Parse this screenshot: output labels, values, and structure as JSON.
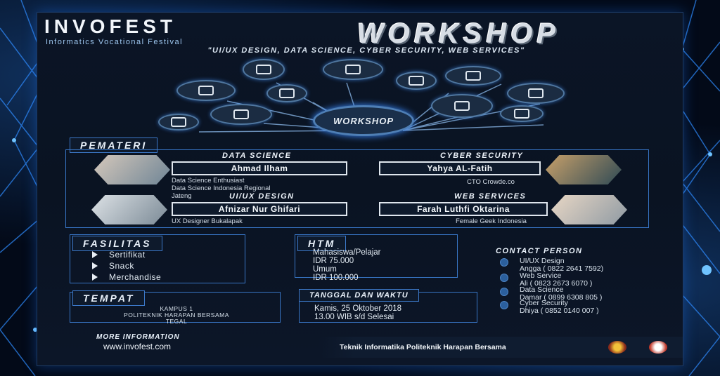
{
  "logo": {
    "name": "INVOFEST",
    "subtitle": "Informatics Vocational Festival"
  },
  "title": "WORKSHOP",
  "topics": "\"UI/UX DESIGN, DATA SCIENCE, CYBER SECURITY, WEB SERVICES\"",
  "center_node": "WORKSHOP",
  "sections": {
    "pemateri": "PEMATERI",
    "fasilitas": "FASILITAS",
    "htm": "HTM",
    "tempat": "TEMPAT",
    "tanggal": "TANGGAL DAN WAKTU",
    "contact": "CONTACT PERSON",
    "more": "MORE INFORMATION"
  },
  "speakers": [
    {
      "topic": "DATA SCIENCE",
      "name": "Ahmad Ilham",
      "desc": [
        "Data Science Enthusiast",
        "Data Science Indonesia Regional",
        "Jateng"
      ]
    },
    {
      "topic": "CYBER SECURITY",
      "name": "Yahya AL-Fatih",
      "desc": [
        "CTO Crowde.co"
      ]
    },
    {
      "topic": "UI/UX DESIGN",
      "name": "Afnizar Nur Ghifari",
      "desc": [
        "UX Designer Bukalapak"
      ]
    },
    {
      "topic": "WEB SERVICES",
      "name": "Farah Luthfi Oktarina",
      "desc": [
        "Female Geek Indonesia"
      ]
    }
  ],
  "fasilitas": [
    "Sertifikat",
    "Snack",
    "Merchandise"
  ],
  "htm": [
    "Mahasiswa/Pelajar",
    "IDR 75.000",
    "Umum",
    "IDR 100.000"
  ],
  "tempat": [
    "KAMPUS 1",
    "POLITEKNIK HARAPAN BERSAMA",
    "TEGAL"
  ],
  "tanggal": [
    "Kamis, 25 Oktober 2018",
    "13.00 WIB s/d Selesai"
  ],
  "contacts": [
    {
      "topic": "UI/UX Design",
      "person": "Angga ( 0822 2641 7592)"
    },
    {
      "topic": "Web Service",
      "person": "Ali ( 0823 2673 6070 )"
    },
    {
      "topic": "Data Science",
      "person": "Damar ( 0899 6308 805 )"
    },
    {
      "topic": "Cyber Security",
      "person": "Dhiya ( 0852 0140 007 )"
    }
  ],
  "website": "www.invofest.com",
  "footer": "Teknik Informatika Politeknik Harapan Bersama",
  "colors": {
    "accent": "#3876c6",
    "glow": "#3b8bff",
    "background": "#0b1526"
  }
}
